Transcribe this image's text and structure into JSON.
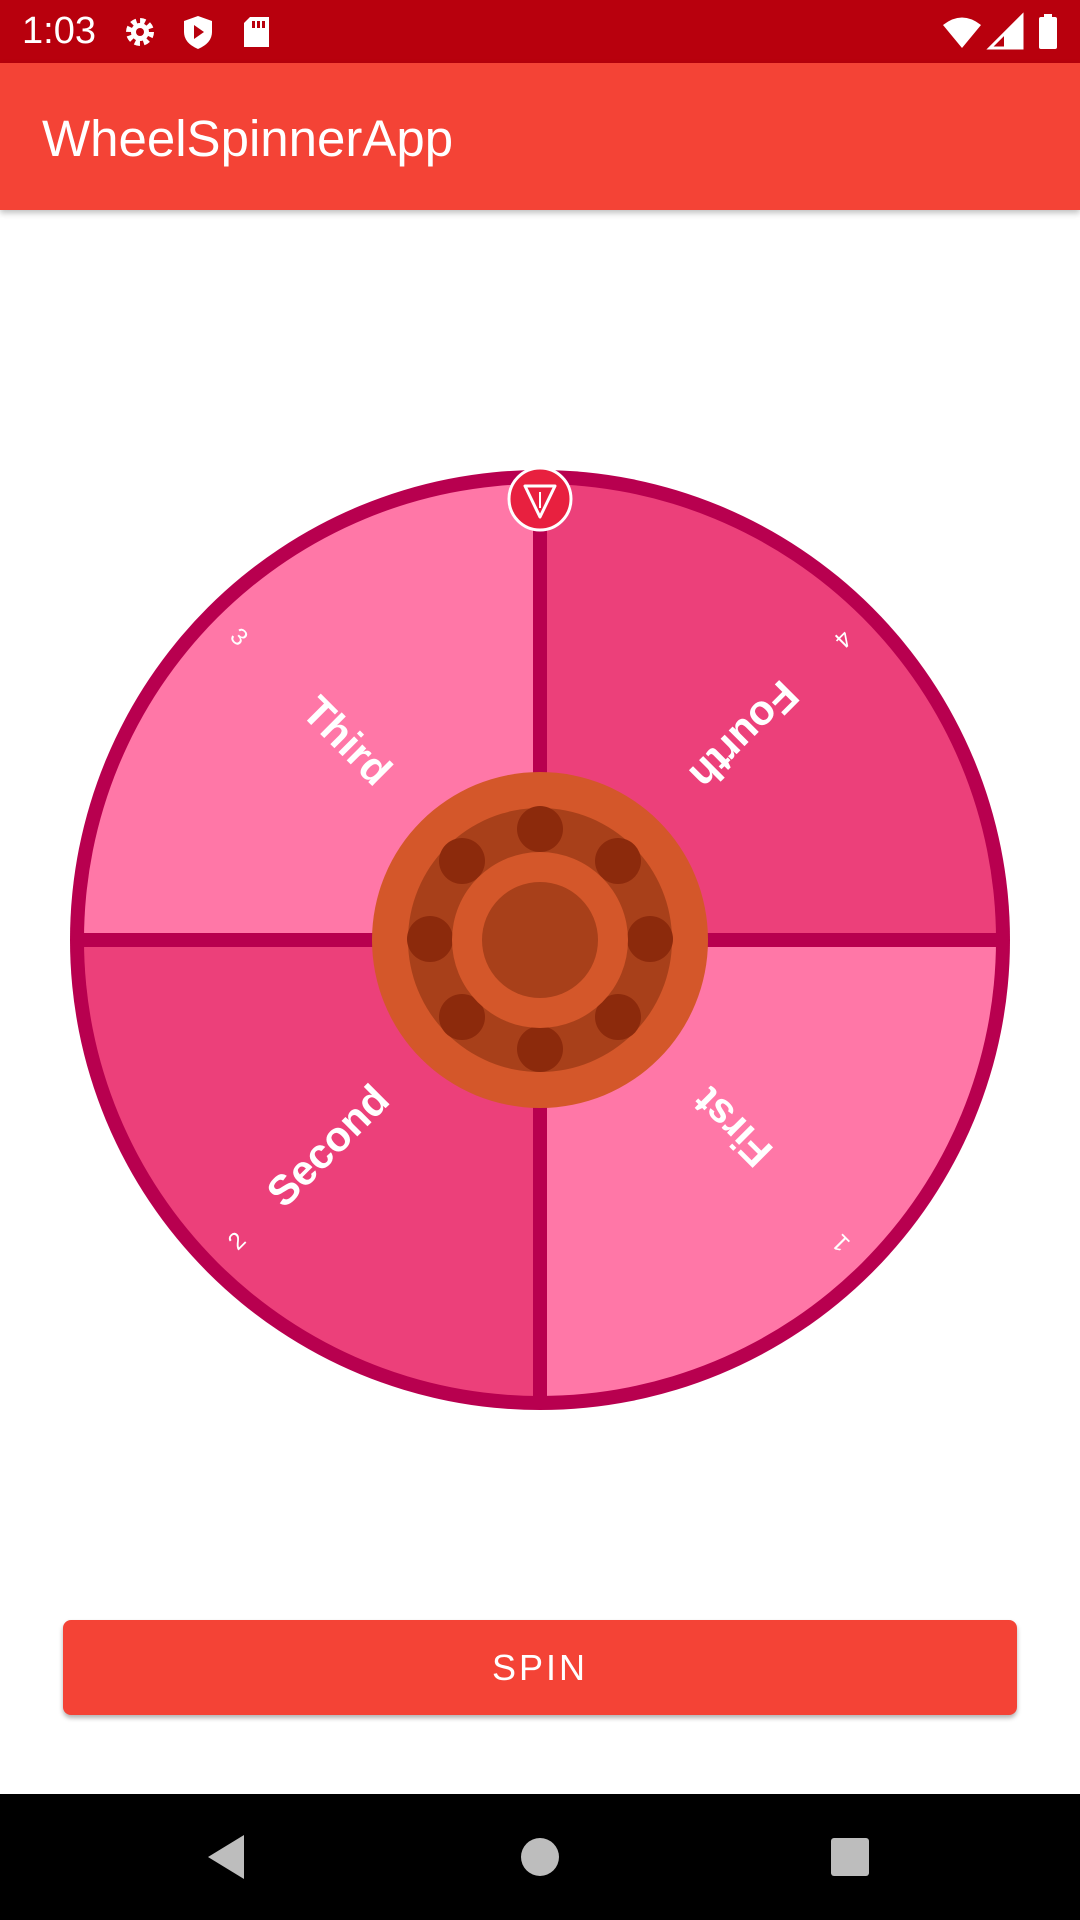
{
  "status_bar": {
    "time": "1:03",
    "icons": [
      "gear-icon",
      "shield-play-icon",
      "sd-card-icon",
      "wifi-icon",
      "signal-icon",
      "battery-icon"
    ],
    "background": "#b8000d"
  },
  "app_bar": {
    "title": "WheelSpinnerApp",
    "background": "#f44336"
  },
  "wheel": {
    "rim_color": "#b8004f",
    "slice_colors": [
      "#ff77a7",
      "#ec407a"
    ],
    "hub_colors": {
      "outer": "#d4572a",
      "ring": "#a8401a",
      "dots": "#8c2a0c",
      "center": "#a8401a"
    },
    "pointer_icon": "pointer-down-icon",
    "slices": [
      {
        "label": "First",
        "number": "1"
      },
      {
        "label": "Second",
        "number": "2"
      },
      {
        "label": "Third",
        "number": "3"
      },
      {
        "label": "Fourth",
        "number": "4"
      }
    ]
  },
  "actions": {
    "spin_label": "SPIN",
    "accent": "#f44336"
  },
  "nav_bar": {
    "icons": [
      "back-icon",
      "home-icon",
      "recents-icon"
    ]
  }
}
